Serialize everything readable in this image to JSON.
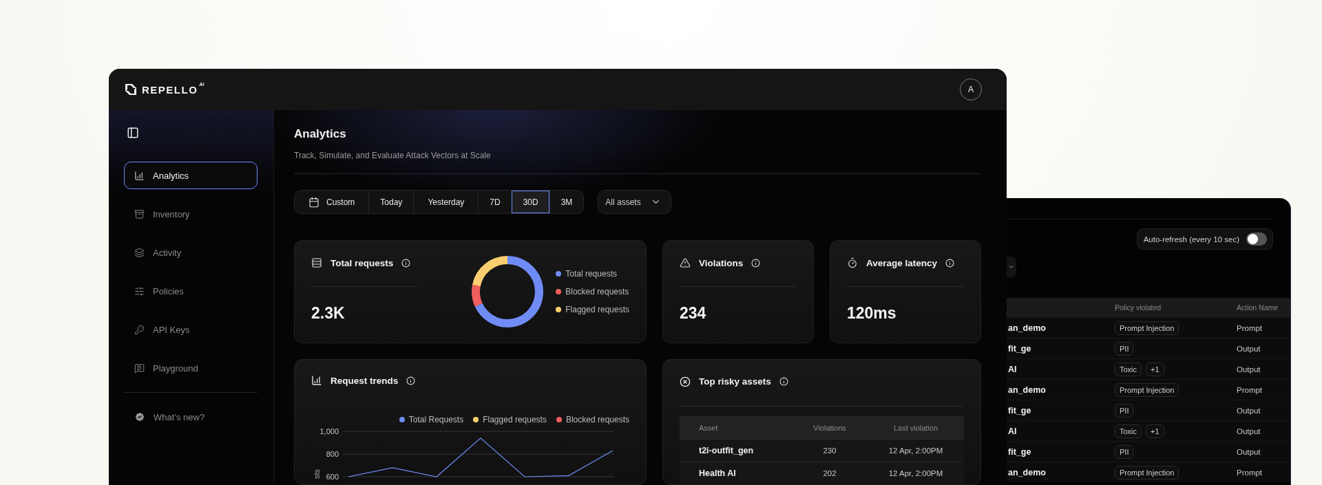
{
  "header": {
    "brand": "REPELLO",
    "brand_mark": "AI",
    "avatar": "A"
  },
  "sidebar": {
    "items": [
      {
        "label": "Analytics",
        "kind": "analytics",
        "selected": true
      },
      {
        "label": "Inventory",
        "kind": "inventory",
        "selected": false
      },
      {
        "label": "Activity",
        "kind": "activity",
        "selected": false
      },
      {
        "label": "Policies",
        "kind": "policies",
        "selected": false
      },
      {
        "label": "API Keys",
        "kind": "keys",
        "selected": false
      },
      {
        "label": "Playground",
        "kind": "playground",
        "selected": false
      }
    ],
    "footer_item": {
      "label": "What’s new?"
    }
  },
  "page": {
    "title": "Analytics",
    "subtitle": "Track, Simulate, and Evaluate Attack Vectors at Scale"
  },
  "filters": {
    "ranges": [
      {
        "label": "Custom",
        "kind": "calendar",
        "selected": false
      },
      {
        "label": "Today",
        "kind": "preset",
        "selected": false
      },
      {
        "label": "Yesterday",
        "kind": "preset",
        "selected": false
      },
      {
        "label": "7D",
        "kind": "preset",
        "selected": false
      },
      {
        "label": "30D",
        "kind": "preset",
        "selected": true
      },
      {
        "label": "3M",
        "kind": "preset",
        "selected": false
      }
    ],
    "asset_dropdown": {
      "value": "All assets"
    }
  },
  "stats": [
    {
      "kind": "requests",
      "title": "Total requests",
      "value": "2.3K",
      "legend": [
        {
          "label": "Total requests",
          "color": "#6f8cf6"
        },
        {
          "label": "Blocked requests",
          "color": "#f05e5e"
        },
        {
          "label": "Flagged requests",
          "color": "#fbcf6f"
        }
      ]
    },
    {
      "kind": "violations",
      "title": "Violations",
      "value": "234"
    },
    {
      "kind": "latency",
      "title": "Average latency",
      "value": "120ms"
    }
  ],
  "request_trends": {
    "title": "Request trends",
    "chart_data": {
      "type": "line",
      "ylabel": "sts",
      "ylim": [
        600,
        1000
      ],
      "yticks": [
        {
          "value": 600,
          "label": "600"
        },
        {
          "value": 800,
          "label": "800"
        },
        {
          "value": 1000,
          "label": "1,000"
        }
      ],
      "series": [
        {
          "name": "Total Requests",
          "color": "#6f8cf6",
          "values": [
            600,
            680,
            600,
            940,
            600,
            610,
            830
          ]
        },
        {
          "name": "Flagged requests",
          "color": "#fbcf6f",
          "values": [
            null,
            null,
            null,
            null,
            null,
            null,
            null
          ]
        },
        {
          "name": "Blocked requests",
          "color": "#f05e5e",
          "values": [
            null,
            null,
            null,
            null,
            null,
            null,
            null
          ]
        }
      ]
    }
  },
  "top_risky_assets": {
    "title": "Top risky assets",
    "columns": [
      "Asset",
      "Violations",
      "Last violation"
    ],
    "rows": [
      [
        "t2i-outfit_gen",
        "230",
        "12 Apr, 2:00PM"
      ],
      [
        "Health AI",
        "202",
        "12 Apr, 2:00PM"
      ]
    ]
  },
  "back_window": {
    "auto_refresh": {
      "label": "Auto-refresh (every 10 sec)",
      "on": false
    },
    "columns": [
      "Policy violated",
      "Action Name"
    ],
    "rows": [
      {
        "asset": "an_demo",
        "policies": [
          "Prompt Injection"
        ],
        "action": "Prompt"
      },
      {
        "asset": "fit_ge",
        "policies": [
          "PII"
        ],
        "action": "Output"
      },
      {
        "asset": "AI",
        "policies": [
          "Toxic",
          "+1"
        ],
        "action": "Output"
      },
      {
        "asset": "an_demo",
        "policies": [
          "Prompt Injection"
        ],
        "action": "Prompt"
      },
      {
        "asset": "fit_ge",
        "policies": [
          "PII"
        ],
        "action": "Output"
      },
      {
        "asset": "AI",
        "policies": [
          "Toxic",
          "+1"
        ],
        "action": "Output"
      },
      {
        "asset": "fit_ge",
        "policies": [
          "PII"
        ],
        "action": "Output"
      },
      {
        "asset": "an_demo",
        "policies": [
          "Prompt Injection"
        ],
        "action": "Prompt"
      }
    ]
  }
}
